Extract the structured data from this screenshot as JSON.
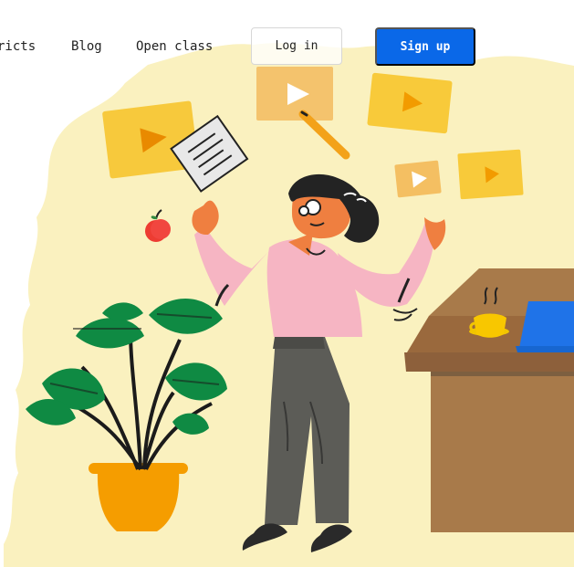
{
  "nav": {
    "links": [
      "ricts",
      "Blog",
      "Open class"
    ],
    "login_label": "Log in",
    "signup_label": "Sign up"
  },
  "colors": {
    "accent": "#0a68e8",
    "background_shape": "#faf1bf",
    "video_tile": "#f7c93c",
    "shirt": "#f5b5c5",
    "pants": "#5d5d58",
    "desk": "#a87a4a",
    "plant": "#138a45",
    "pot": "#f5a500"
  }
}
